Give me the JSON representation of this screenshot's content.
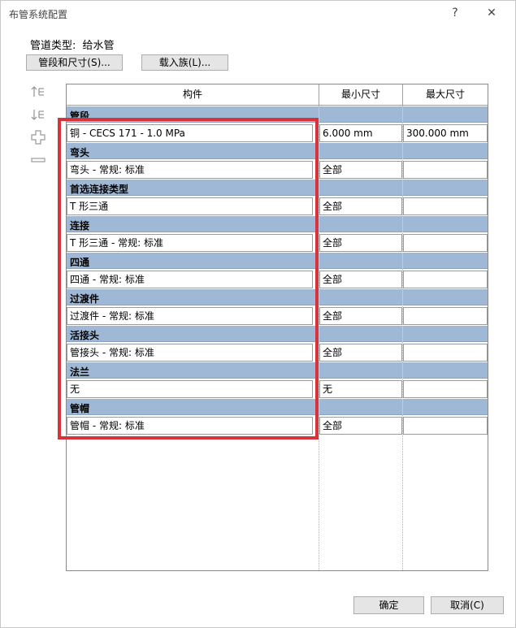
{
  "window": {
    "title": "布管系统配置",
    "help": "?",
    "close": "✕"
  },
  "pipe_type": {
    "label": "管道类型:",
    "value": "给水管"
  },
  "buttons": {
    "segments": "管段和尺寸(S)...",
    "load_family": "载入族(L)..."
  },
  "columns": {
    "component": "构件",
    "min_size": "最小尺寸",
    "max_size": "最大尺寸"
  },
  "groups": [
    {
      "name": "管段",
      "item": "铜 - CECS 171 - 1.0 MPa",
      "min": "6.000 mm",
      "max": "300.000 mm"
    },
    {
      "name": "弯头",
      "item": "弯头 - 常规: 标准",
      "min": "全部",
      "max": ""
    },
    {
      "name": "首选连接类型",
      "item": "T 形三通",
      "min": "全部",
      "max": ""
    },
    {
      "name": "连接",
      "item": "T 形三通 - 常规: 标准",
      "min": "全部",
      "max": ""
    },
    {
      "name": "四通",
      "item": "四通 - 常规: 标准",
      "min": "全部",
      "max": ""
    },
    {
      "name": "过渡件",
      "item": "过渡件 - 常规: 标准",
      "min": "全部",
      "max": ""
    },
    {
      "name": "活接头",
      "item": "管接头 - 常规: 标准",
      "min": "全部",
      "max": ""
    },
    {
      "name": "法兰",
      "item": "无",
      "min": "无",
      "max": ""
    },
    {
      "name": "管帽",
      "item": "管帽 - 常规: 标准",
      "min": "全部",
      "max": ""
    }
  ],
  "footer": {
    "ok": "确定",
    "cancel": "取消(C)"
  },
  "colors": {
    "group_header": "#9fb8d6",
    "highlight_box": "#d8333a"
  }
}
